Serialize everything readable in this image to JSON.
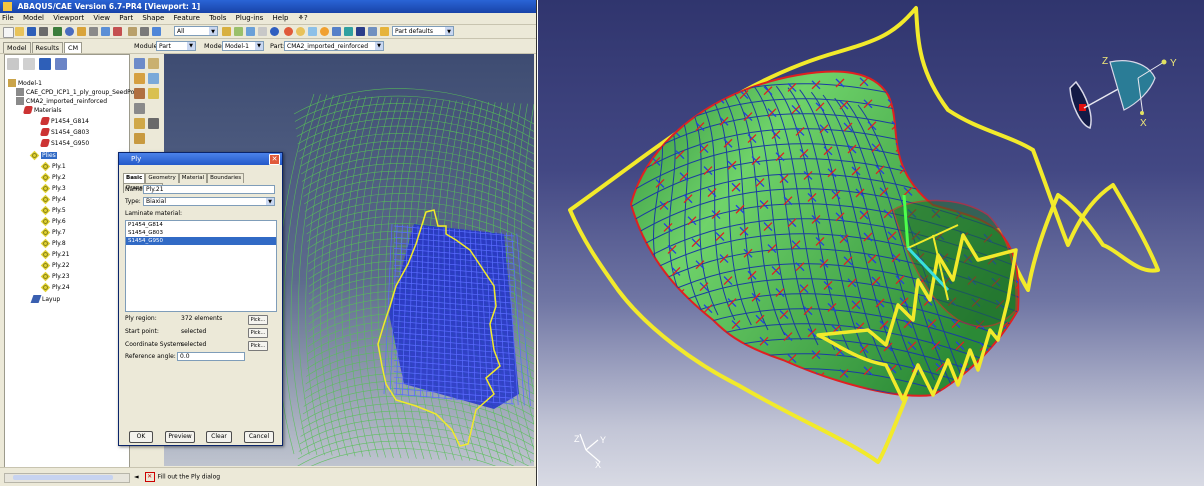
{
  "window": {
    "title": "ABAQUS/CAE Version 6.7-PR4 [Viewport: 1]",
    "menu": [
      "File",
      "Model",
      "Viewport",
      "View",
      "Part",
      "Shape",
      "Feature",
      "Tools",
      "Plug-ins",
      "Help"
    ],
    "help_glyph": "⚘?"
  },
  "toolbar": {
    "filter_value": "All",
    "defaults_value": "Part defaults"
  },
  "context": {
    "tabs": [
      "Model",
      "Results",
      "CM"
    ],
    "module_label": "Module:",
    "module_value": "Part",
    "model_label": "Model:",
    "model_value": "Model-1",
    "part_label": "Part:",
    "part_value": "CMA2_imported_reinforced"
  },
  "tree": {
    "root": "Model-1",
    "items": [
      {
        "text": "CAE_CPD_ICP1_1_ply_group_SeedPor",
        "level": 1
      },
      {
        "text": "CMA2_imported_reinforced",
        "level": 1
      },
      {
        "text": "Materials",
        "level": 2
      },
      {
        "text": "P1454_G814",
        "level": 3
      },
      {
        "text": "S1454_G803",
        "level": 3
      },
      {
        "text": "S1454_G950",
        "level": 3
      },
      {
        "text": "Plies",
        "level": 2
      },
      {
        "text": "Ply.1",
        "level": 3
      },
      {
        "text": "Ply.2",
        "level": 3
      },
      {
        "text": "Ply.3",
        "level": 3
      },
      {
        "text": "Ply.4",
        "level": 3
      },
      {
        "text": "Ply.5",
        "level": 3
      },
      {
        "text": "Ply.6",
        "level": 3
      },
      {
        "text": "Ply.7",
        "level": 3
      },
      {
        "text": "Ply.8",
        "level": 3
      },
      {
        "text": "Ply.21",
        "level": 3
      },
      {
        "text": "Ply.22",
        "level": 3
      },
      {
        "text": "Ply.23",
        "level": 3
      },
      {
        "text": "Ply.24",
        "level": 3
      },
      {
        "text": "Layup",
        "level": 2
      }
    ]
  },
  "dialog": {
    "title": "Ply",
    "tabs": [
      "Basic",
      "Geometry",
      "Material",
      "Boundaries",
      "Drape Order"
    ],
    "name_label": "Name:",
    "name_value": "Ply.21",
    "type_label": "Type:",
    "type_value": "Biaxial",
    "laminate_label": "Laminate material:",
    "materials": [
      "P1454_G814",
      "S1454_G803",
      "S1454_G950"
    ],
    "selected_material": "S1454_G950",
    "region_label": "Ply region:",
    "region_value": "372 elements",
    "start_label": "Start point:",
    "start_value": "selected",
    "csys_label": "Coordinate System:",
    "csys_value": "selected",
    "refangle_label": "Reference angle:",
    "refangle_value": "0.0",
    "pick_label": "Pick...",
    "buttons": {
      "ok": "OK",
      "preview": "Preview",
      "clear": "Clear",
      "cancel": "Cancel"
    }
  },
  "statusbar": {
    "prompt": "Fill out the Ply dialog"
  },
  "viewport2": {
    "triad_labels": {
      "z": "Z",
      "y": "Y",
      "x": "X"
    }
  },
  "colors": {
    "title_blue": "#2359c9",
    "selection_blue": "#316ac5",
    "ply_yellow": "#f2ea2b",
    "mesh_green": "#3cae3c",
    "edge_red": "#e02020"
  }
}
